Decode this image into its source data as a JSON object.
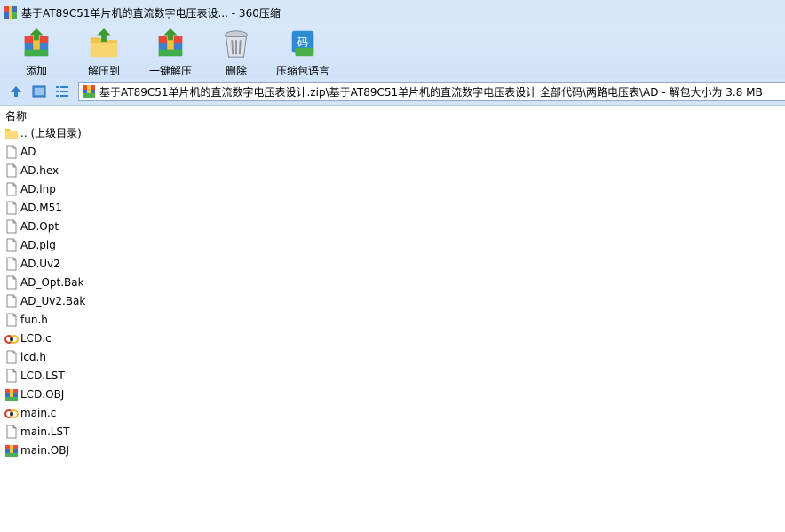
{
  "window": {
    "title": "基于AT89C51单片机的直流数字电压表设... - 360压缩"
  },
  "toolbar": {
    "items": [
      {
        "label": "添加",
        "icon": "add-archive-icon"
      },
      {
        "label": "解压到",
        "icon": "extract-to-icon"
      },
      {
        "label": "一键解压",
        "icon": "one-click-extract-icon"
      },
      {
        "label": "删除",
        "icon": "delete-trash-icon"
      },
      {
        "label": "压缩包语言",
        "icon": "archive-language-icon"
      }
    ]
  },
  "address": {
    "path": "基于AT89C51单片机的直流数字电压表设计.zip\\基于AT89C51单片机的直流数字电压表设计 全部代码\\两路电压表\\AD - 解包大小为 3.8 MB"
  },
  "list": {
    "column_name": "名称",
    "files": [
      {
        "name": ".. (上级目录)",
        "type": "folder"
      },
      {
        "name": "AD",
        "type": "file"
      },
      {
        "name": "AD.hex",
        "type": "file"
      },
      {
        "name": "AD.lnp",
        "type": "file"
      },
      {
        "name": "AD.M51",
        "type": "file"
      },
      {
        "name": "AD.Opt",
        "type": "file"
      },
      {
        "name": "AD.plg",
        "type": "file"
      },
      {
        "name": "AD.Uv2",
        "type": "file"
      },
      {
        "name": "AD_Opt.Bak",
        "type": "file"
      },
      {
        "name": "AD_Uv2.Bak",
        "type": "file"
      },
      {
        "name": "fun.h",
        "type": "file"
      },
      {
        "name": "LCD.c",
        "type": "c"
      },
      {
        "name": "lcd.h",
        "type": "file"
      },
      {
        "name": "LCD.LST",
        "type": "file"
      },
      {
        "name": "LCD.OBJ",
        "type": "obj"
      },
      {
        "name": "main.c",
        "type": "c"
      },
      {
        "name": "main.LST",
        "type": "file"
      },
      {
        "name": "main.OBJ",
        "type": "obj"
      }
    ]
  }
}
